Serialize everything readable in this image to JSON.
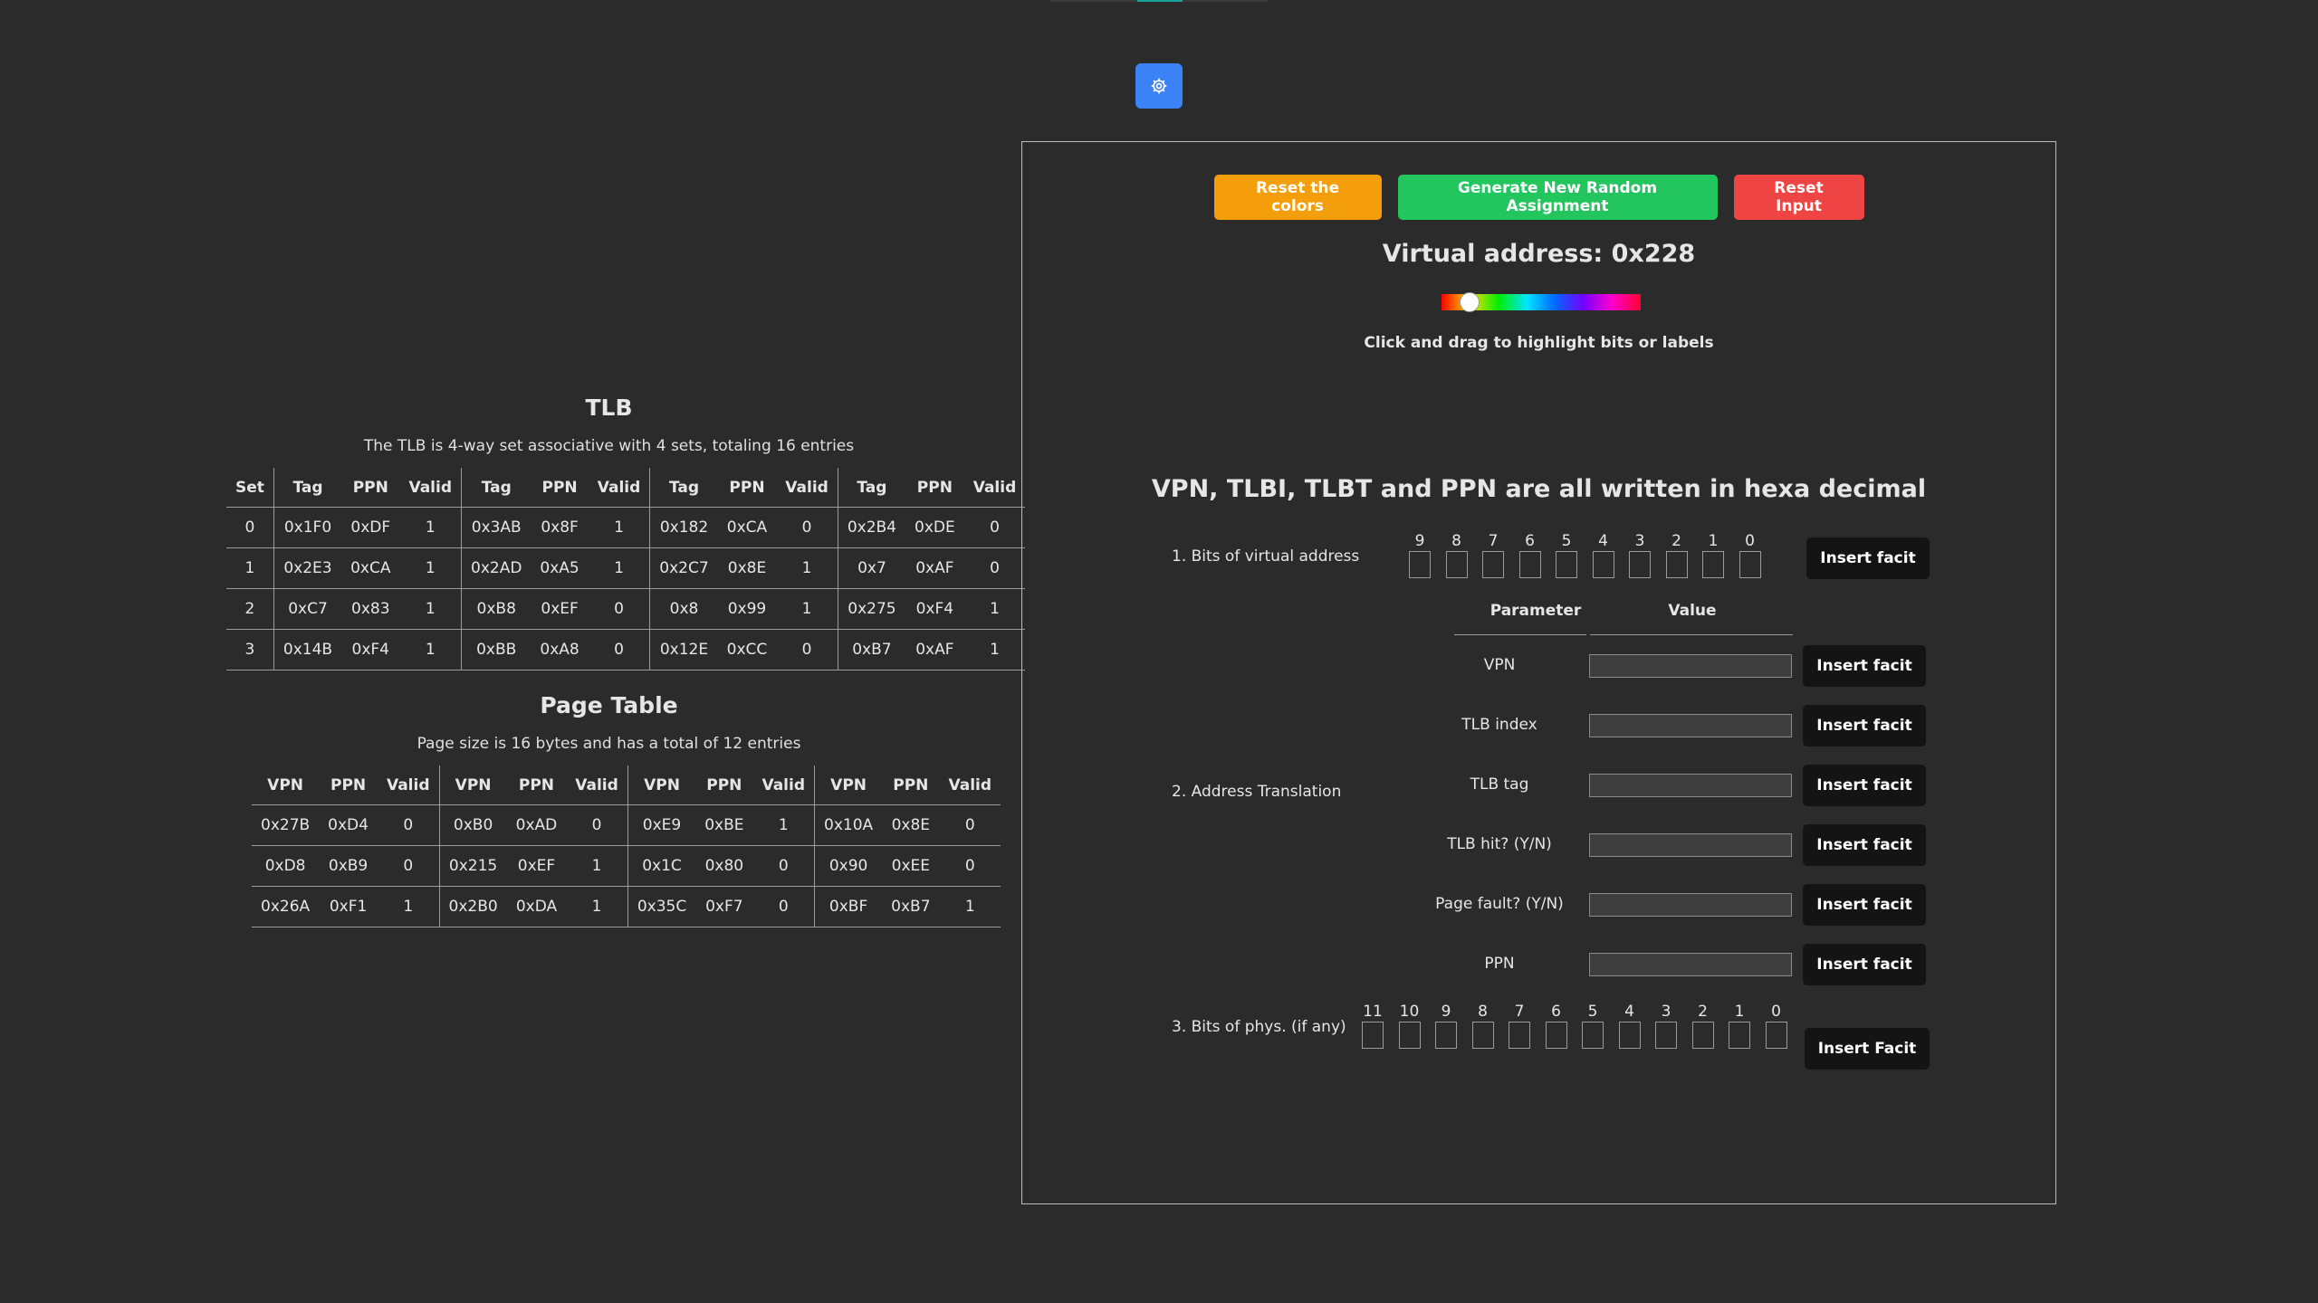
{
  "settings": {
    "icon": "gear-icon"
  },
  "tlb": {
    "title": "TLB",
    "subtitle": "The TLB is 4-way set associative with 4 sets, totaling 16 entries",
    "headers": [
      "Set",
      "Tag",
      "PPN",
      "Valid",
      "Tag",
      "PPN",
      "Valid",
      "Tag",
      "PPN",
      "Valid",
      "Tag",
      "PPN",
      "Valid"
    ],
    "rows": [
      [
        "0",
        "0x1F0",
        "0xDF",
        "1",
        "0x3AB",
        "0x8F",
        "1",
        "0x182",
        "0xCA",
        "0",
        "0x2B4",
        "0xDE",
        "0"
      ],
      [
        "1",
        "0x2E3",
        "0xCA",
        "1",
        "0x2AD",
        "0xA5",
        "1",
        "0x2C7",
        "0x8E",
        "1",
        "0x7",
        "0xAF",
        "0"
      ],
      [
        "2",
        "0xC7",
        "0x83",
        "1",
        "0xB8",
        "0xEF",
        "0",
        "0x8",
        "0x99",
        "1",
        "0x275",
        "0xF4",
        "1"
      ],
      [
        "3",
        "0x14B",
        "0xF4",
        "1",
        "0xBB",
        "0xA8",
        "0",
        "0x12E",
        "0xCC",
        "0",
        "0xB7",
        "0xAF",
        "1"
      ]
    ]
  },
  "page_table": {
    "title": "Page Table",
    "subtitle": "Page size is 16 bytes and has a total of 12 entries",
    "headers": [
      "VPN",
      "PPN",
      "Valid",
      "VPN",
      "PPN",
      "Valid",
      "VPN",
      "PPN",
      "Valid",
      "VPN",
      "PPN",
      "Valid"
    ],
    "rows": [
      [
        "0x27B",
        "0xD4",
        "0",
        "0xB0",
        "0xAD",
        "0",
        "0xE9",
        "0xBE",
        "1",
        "0x10A",
        "0x8E",
        "0"
      ],
      [
        "0xD8",
        "0xB9",
        "0",
        "0x215",
        "0xEF",
        "1",
        "0x1C",
        "0x80",
        "0",
        "0x90",
        "0xEE",
        "0"
      ],
      [
        "0x26A",
        "0xF1",
        "1",
        "0x2B0",
        "0xDA",
        "1",
        "0x35C",
        "0xF7",
        "0",
        "0xBF",
        "0xB7",
        "1"
      ]
    ]
  },
  "panel": {
    "buttons": {
      "reset_colors": "Reset the colors",
      "generate": "Generate New Random Assignment",
      "reset_input": "Reset Input"
    },
    "virtual_address": "Virtual address: 0x228",
    "slider_position": 0.09,
    "hint": "Click and drag to highlight bits or labels",
    "hex_note": "VPN, TLBI, TLBT and PPN are all written in hexa decimal",
    "virtual_bits": {
      "label": "1. Bits of virtual address",
      "numbers": [
        "9",
        "8",
        "7",
        "6",
        "5",
        "4",
        "3",
        "2",
        "1",
        "0"
      ],
      "button": "Insert facit"
    },
    "translation": {
      "label": "2. Address Translation",
      "param_header": "Parameter",
      "value_header": "Value",
      "params": [
        {
          "label": "VPN",
          "button": "Insert facit"
        },
        {
          "label": "TLB index",
          "button": "Insert facit"
        },
        {
          "label": "TLB tag",
          "button": "Insert facit"
        },
        {
          "label": "TLB hit? (Y/N)",
          "button": "Insert facit"
        },
        {
          "label": "Page fault? (Y/N)",
          "button": "Insert facit"
        },
        {
          "label": "PPN",
          "button": "Insert facit"
        }
      ]
    },
    "phys_bits": {
      "label": "3. Bits of phys. (if any)",
      "numbers": [
        "11",
        "10",
        "9",
        "8",
        "7",
        "6",
        "5",
        "4",
        "3",
        "2",
        "1",
        "0"
      ],
      "button": "Insert Facit"
    }
  },
  "colors": {
    "background": "#2b2b2b",
    "settings_blue": "#3b82f6",
    "orange": "#f59e0b",
    "green": "#22c55e",
    "red": "#ef4444",
    "dark_button": "#141414"
  }
}
